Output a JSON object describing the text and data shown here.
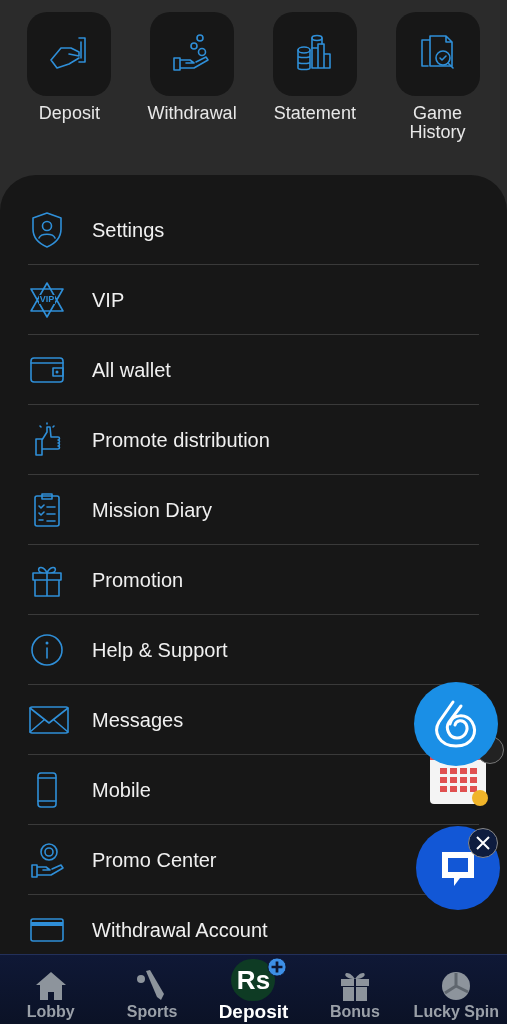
{
  "quick_actions": [
    {
      "kind": "deposit",
      "label": "Deposit"
    },
    {
      "kind": "withdrawal",
      "label": "Withdrawal"
    },
    {
      "kind": "statement",
      "label": "Statement"
    },
    {
      "kind": "history",
      "label": "Game History"
    }
  ],
  "menu": [
    {
      "kind": "settings",
      "label": "Settings"
    },
    {
      "kind": "vip",
      "label": "VIP",
      "icon_text": "VIP"
    },
    {
      "kind": "wallet",
      "label": "All wallet"
    },
    {
      "kind": "promote",
      "label": "Promote distribution"
    },
    {
      "kind": "mission",
      "label": "Mission Diary"
    },
    {
      "kind": "gift",
      "label": "Promotion"
    },
    {
      "kind": "help",
      "label": "Help & Support"
    },
    {
      "kind": "messages",
      "label": "Messages"
    },
    {
      "kind": "mobile",
      "label": "Mobile"
    },
    {
      "kind": "promo",
      "label": "Promo Center"
    },
    {
      "kind": "card",
      "label": "Withdrawal Account"
    }
  ],
  "bottom_nav": [
    {
      "kind": "lobby",
      "label": "Lobby",
      "selected": false
    },
    {
      "kind": "sports",
      "label": "Sports",
      "selected": false
    },
    {
      "kind": "deposit",
      "label": "Deposit",
      "selected": true,
      "icon_text": "Rs"
    },
    {
      "kind": "bonus",
      "label": "Bonus",
      "selected": false
    },
    {
      "kind": "spin",
      "label": "Lucky Spin",
      "selected": false
    }
  ]
}
